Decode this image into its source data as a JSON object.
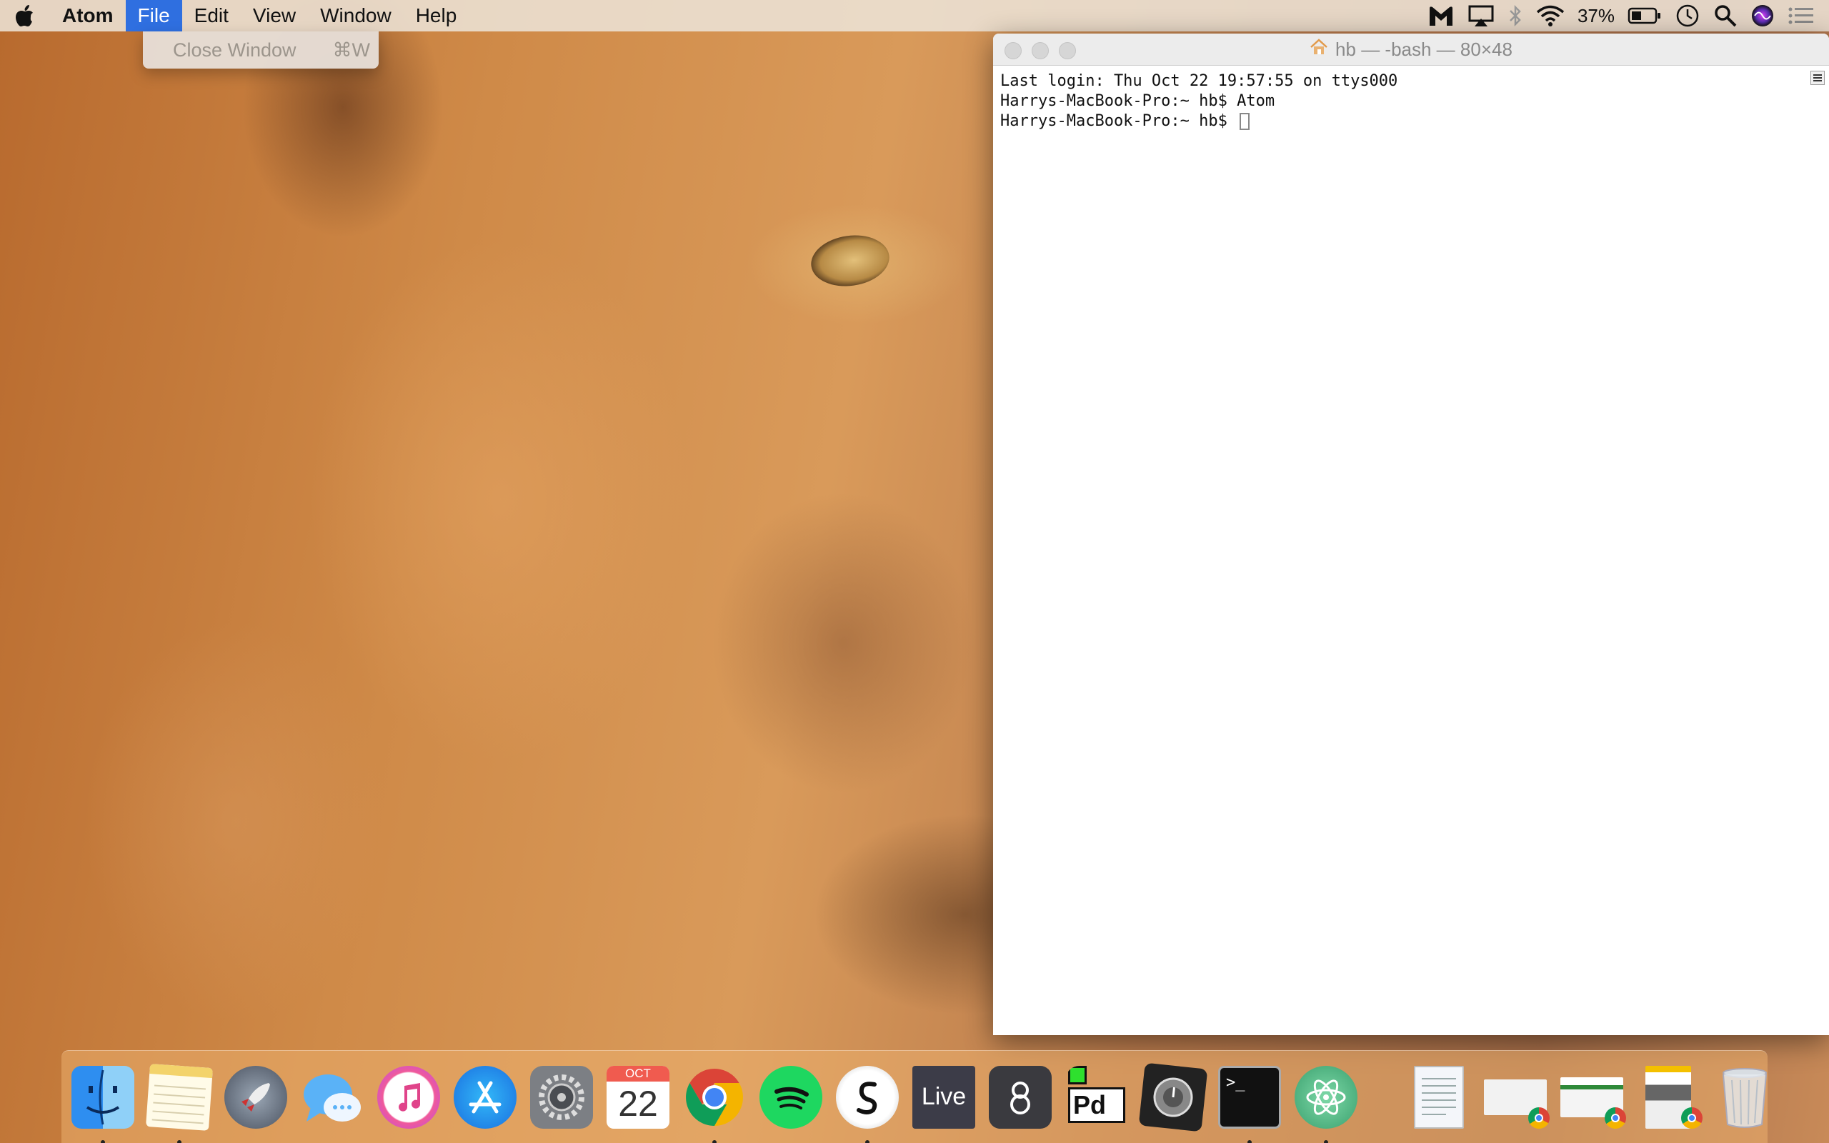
{
  "menubar": {
    "app_name": "Atom",
    "menus": [
      "File",
      "Edit",
      "View",
      "Window",
      "Help"
    ],
    "active_menu": "File",
    "battery_percent": "37%"
  },
  "file_menu": {
    "items": [
      {
        "label": "Close Window",
        "shortcut": "⌘W",
        "enabled": false
      }
    ]
  },
  "terminal": {
    "title": "hb — -bash — 80×48",
    "lines": [
      "Last login: Thu Oct 22 19:57:55 on ttys000",
      "Harrys-MacBook-Pro:~ hb$ Atom",
      "Harrys-MacBook-Pro:~ hb$ "
    ]
  },
  "dock": {
    "calendar_month": "OCT",
    "calendar_day": "22",
    "live_label": "Live",
    "pd_label": "Pd",
    "terminal_prompt": ">_"
  },
  "colors": {
    "menu_highlight": "#2f6fe0",
    "chrome_red": "#db4437",
    "chrome_green": "#0f9d58",
    "chrome_yellow": "#f4b400",
    "chrome_blue": "#4285f4",
    "spotify_green": "#1ed760"
  }
}
